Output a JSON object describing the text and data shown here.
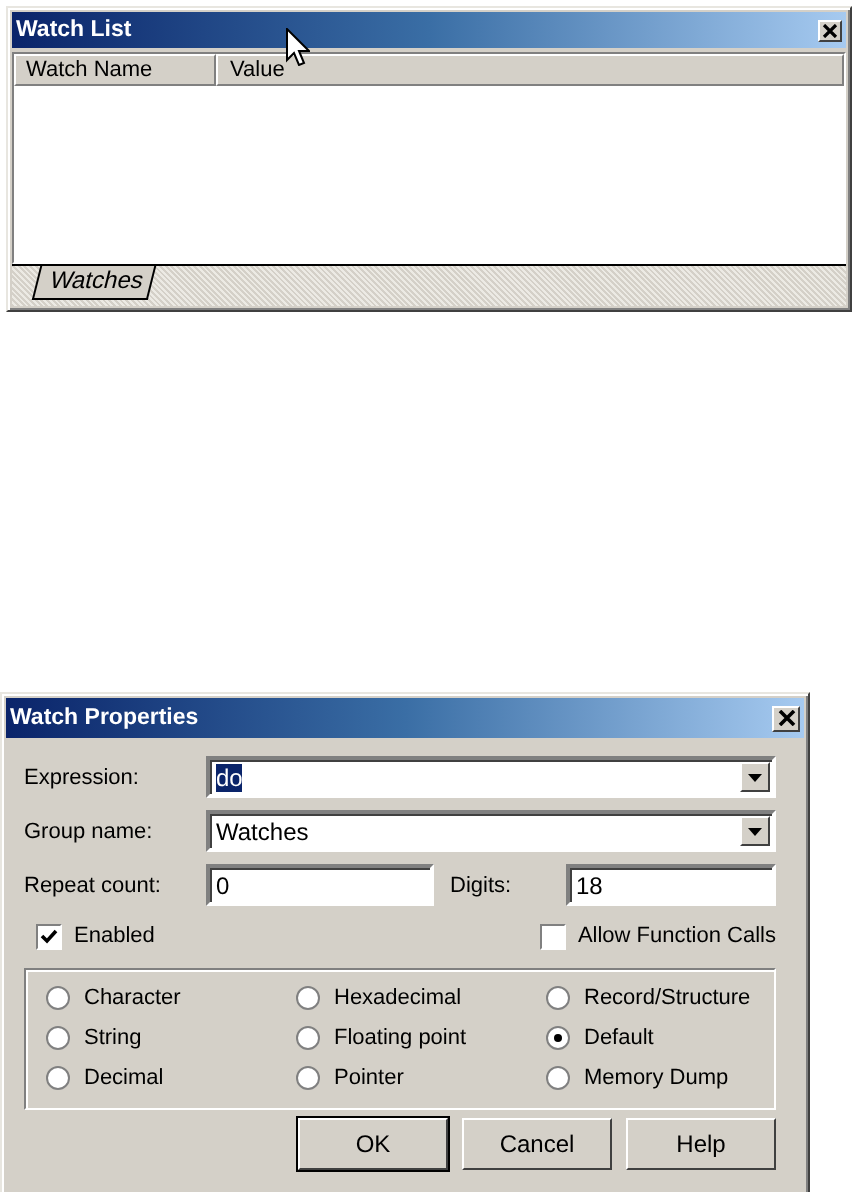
{
  "watch_list": {
    "title": "Watch List",
    "columns": [
      "Watch Name",
      "Value"
    ],
    "tabs": [
      {
        "label": "Watches",
        "selected": true
      }
    ]
  },
  "dialog": {
    "title": "Watch Properties",
    "expression": {
      "label": "Expression:",
      "value": "do"
    },
    "group_name": {
      "label": "Group name:",
      "value": "Watches"
    },
    "repeat_count": {
      "label": "Repeat count:",
      "value": "0"
    },
    "digits": {
      "label": "Digits:",
      "value": "18"
    },
    "enabled": {
      "label": "Enabled",
      "checked": true
    },
    "allow_function_calls": {
      "label": "Allow Function Calls",
      "checked": false
    },
    "formats": [
      {
        "label": "Character",
        "selected": false
      },
      {
        "label": "Hexadecimal",
        "selected": false
      },
      {
        "label": "Record/Structure",
        "selected": false
      },
      {
        "label": "String",
        "selected": false
      },
      {
        "label": "Floating point",
        "selected": false
      },
      {
        "label": "Default",
        "selected": true
      },
      {
        "label": "Decimal",
        "selected": false
      },
      {
        "label": "Pointer",
        "selected": false
      },
      {
        "label": "Memory Dump",
        "selected": false
      }
    ],
    "buttons": [
      "OK",
      "Cancel",
      "Help"
    ]
  }
}
